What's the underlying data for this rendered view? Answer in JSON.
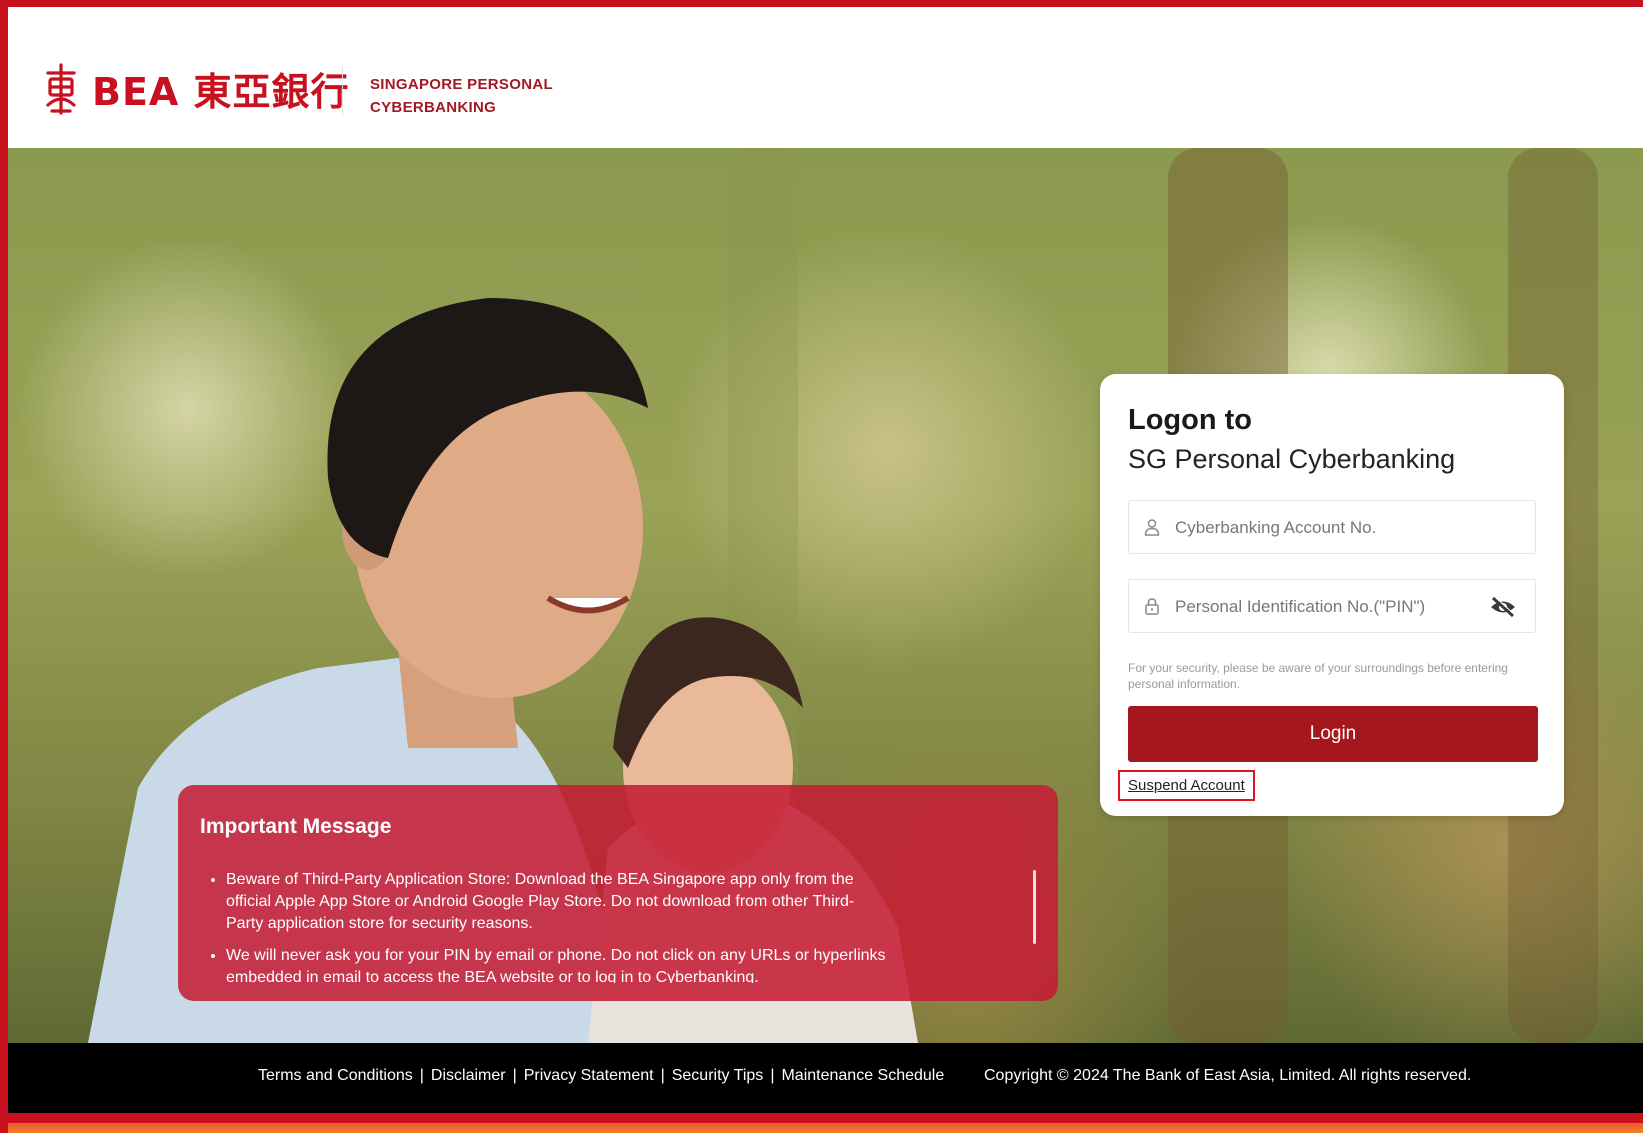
{
  "header": {
    "logo_text": "BEA 東亞銀行",
    "subtitle_line1": "SINGAPORE PERSONAL",
    "subtitle_line2": "CYBERBANKING"
  },
  "login": {
    "title": "Logon to",
    "subtitle": "SG Personal Cyberbanking",
    "account_placeholder": "Cyberbanking Account No.",
    "pin_placeholder": "Personal Identification No.(\"PIN\")",
    "security_note": "For your security, please be aware of your surroundings before entering personal information.",
    "login_label": "Login",
    "suspend_label": "Suspend Account"
  },
  "important_message": {
    "title": "Important Message",
    "items": [
      "Beware of Third-Party Application Store: Download the BEA Singapore app only from the official Apple App Store or Android Google Play Store. Do not download from other Third-Party application store for security reasons.",
      "We will never ask you for your PIN by email or phone. Do not click on any URLs or hyperlinks embedded in email to access the BEA website or to log in to Cyberbanking."
    ]
  },
  "footer": {
    "links": [
      "Terms and Conditions",
      "Disclaimer",
      "Privacy Statement",
      "Security Tips",
      "Maintenance Schedule"
    ],
    "copyright": "Copyright © 2024 The Bank of East Asia, Limited. All rights reserved."
  },
  "icons": {
    "logo": "bea-logo-icon",
    "account": "user-icon",
    "pin": "lock-icon",
    "toggle": "eye-slash-icon"
  },
  "colors": {
    "brand_red": "#c8101e",
    "button_red": "#a5171c",
    "footer_bg": "#000000"
  }
}
